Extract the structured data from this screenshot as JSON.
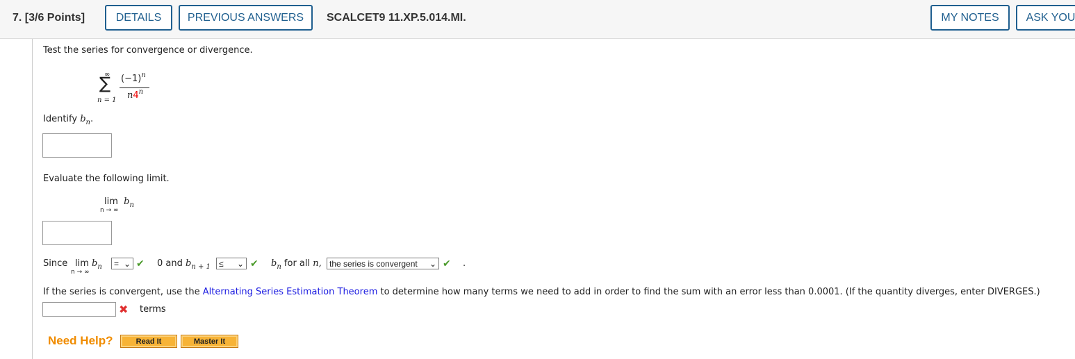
{
  "header": {
    "question": "7. [3/6 Points]",
    "details": "DETAILS",
    "previous_answers": "PREVIOUS ANSWERS",
    "code": "SCALCET9 11.XP.5.014.MI.",
    "my_notes": "MY NOTES",
    "ask": "ASK YOU"
  },
  "prompt": "Test the series for convergence or divergence.",
  "series": {
    "upper": "∞",
    "lower": "n = 1",
    "numerator": "(−1)",
    "num_exp": "n",
    "den_n": "n",
    "den_base": "4",
    "den_exp": "n"
  },
  "identify": {
    "text": "Identify ",
    "var": "b",
    "sub": "n",
    "end": "."
  },
  "evaluate": "Evaluate the following limit.",
  "limit": {
    "lim": "lim",
    "under": "n → ∞",
    "var": "b",
    "sub": "n"
  },
  "since": {
    "since": "Since",
    "eq_value": "=",
    "mid": "0 and",
    "var": "b",
    "sub1": "n + 1",
    "le_value": "≤",
    "sub2": "n",
    "for_all": "for all",
    "n": "n,",
    "conclusion": "the series is convergent",
    "period": "."
  },
  "estimate": {
    "before": "If the series is convergent, use the ",
    "link": "Alternating Series Estimation Theorem",
    "after": " to determine how many terms we need to add in order to find the sum with an error less than 0.0001. (If the quantity diverges, enter DIVERGES.)",
    "unit": "terms"
  },
  "help": {
    "label": "Need Help?",
    "read": "Read It",
    "master": "Master It"
  }
}
